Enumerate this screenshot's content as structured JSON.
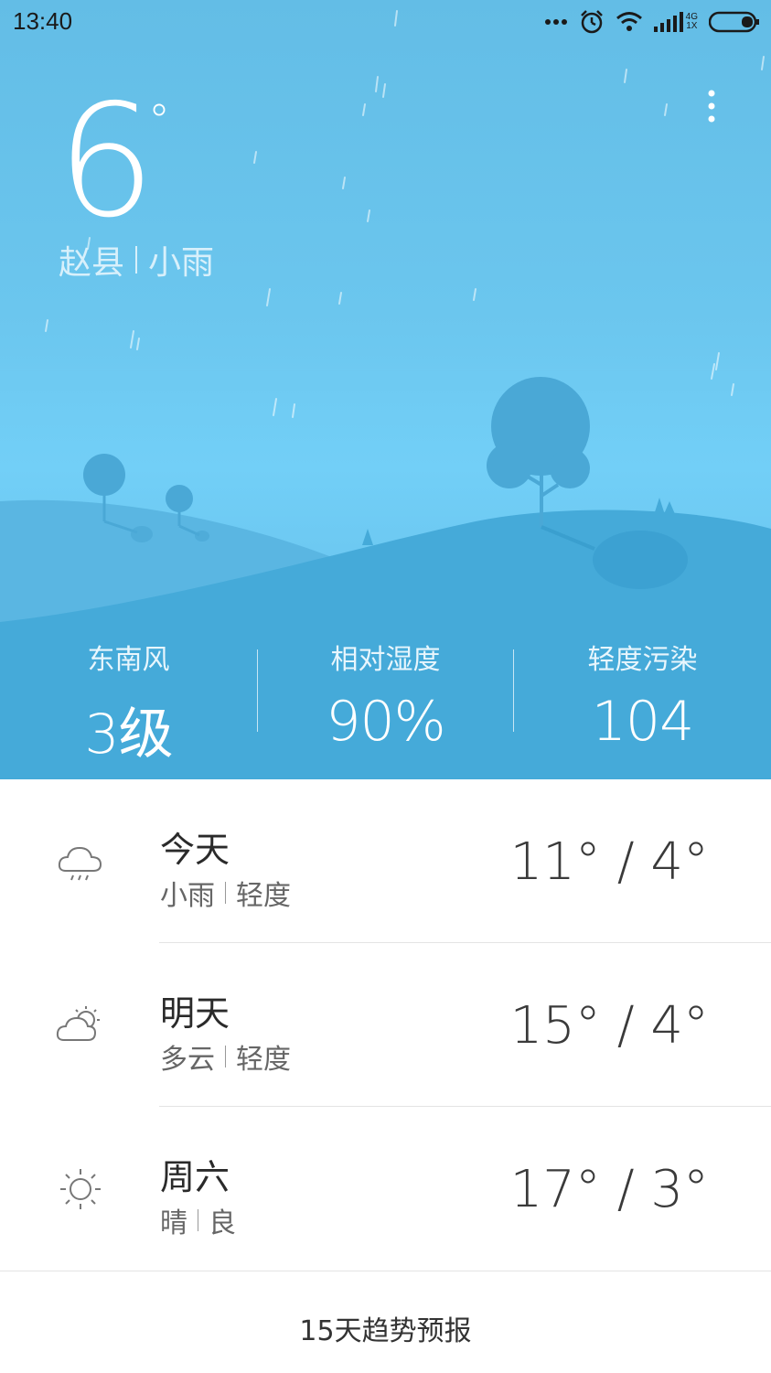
{
  "status_bar": {
    "time": "13:40",
    "network": "4G",
    "network_sub": "1X",
    "icons": [
      "dots-icon",
      "alarm-icon",
      "wifi-icon",
      "signal-icon",
      "battery-icon"
    ]
  },
  "current": {
    "temperature": "6",
    "unit": "°",
    "city": "赵县",
    "condition": "小雨"
  },
  "stats": [
    {
      "label": "东南风",
      "value": "3级"
    },
    {
      "label": "相对湿度",
      "value": "90%"
    },
    {
      "label": "轻度污染",
      "value": "104"
    }
  ],
  "forecast": [
    {
      "day": "今天",
      "weather": "小雨",
      "air": "轻度",
      "temp": "11° / 4°",
      "icon": "rain-cloud-icon"
    },
    {
      "day": "明天",
      "weather": "多云",
      "air": "轻度",
      "temp": "15° / 4°",
      "icon": "partly-cloudy-icon"
    },
    {
      "day": "周六",
      "weather": "晴",
      "air": "良",
      "temp": "17° / 3°",
      "icon": "sun-icon"
    }
  ],
  "trend_label": "15天趋势预报",
  "colors": {
    "sky_top": "#63bde6",
    "sky_mid": "#72cff7",
    "hill_back": "#5fb9e4",
    "hill_front": "#45aad9",
    "text_dark": "#2a2a2a"
  }
}
